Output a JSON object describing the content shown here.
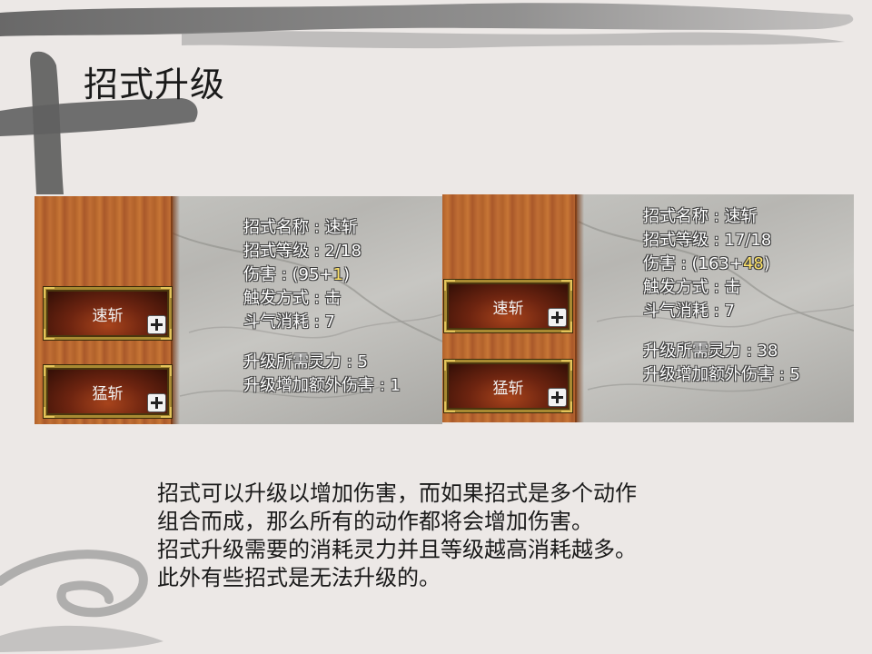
{
  "slide": {
    "title": "招式升级",
    "caption_lines": [
      "招式可以升级以增加伤害，而如果招式是多个动作",
      "组合而成，那么所有的动作都将会增加伤害。",
      "招式升级需要的消耗灵力并且等级越高消耗越多。",
      "此外有些招式是无法升级的。"
    ]
  },
  "screens": [
    {
      "skills": [
        {
          "label": "速斩"
        },
        {
          "label": "猛斩"
        }
      ],
      "info": {
        "name": "招式名称 : 速斩",
        "level": "招式等级 : 2/18",
        "damage_prefix": "伤害 : (95+",
        "damage_bonus": "1",
        "damage_suffix": ")",
        "trigger": "触发方式 : 击",
        "cost": "斗气消耗 : 7",
        "upgrade_cost": "升级所需灵力 : 5",
        "upgrade_damage": "升级增加额外伤害 : 1"
      }
    },
    {
      "skills": [
        {
          "label": "速斩"
        },
        {
          "label": "猛斩"
        }
      ],
      "info": {
        "name": "招式名称 : 速斩",
        "level": "招式等级 : 17/18",
        "damage_prefix": "伤害 : (163+",
        "damage_bonus": "48",
        "damage_suffix": ")",
        "trigger": "触发方式 : 击",
        "cost": "斗气消耗 : 7",
        "upgrade_cost": "升级所需灵力 : 38",
        "upgrade_damage": "升级增加额外伤害 : 5"
      }
    }
  ],
  "colors": {
    "background": "#ece8e6",
    "brush": "#6e6e6e",
    "highlight": "#ffe46a",
    "button_border": "#a88a32"
  }
}
